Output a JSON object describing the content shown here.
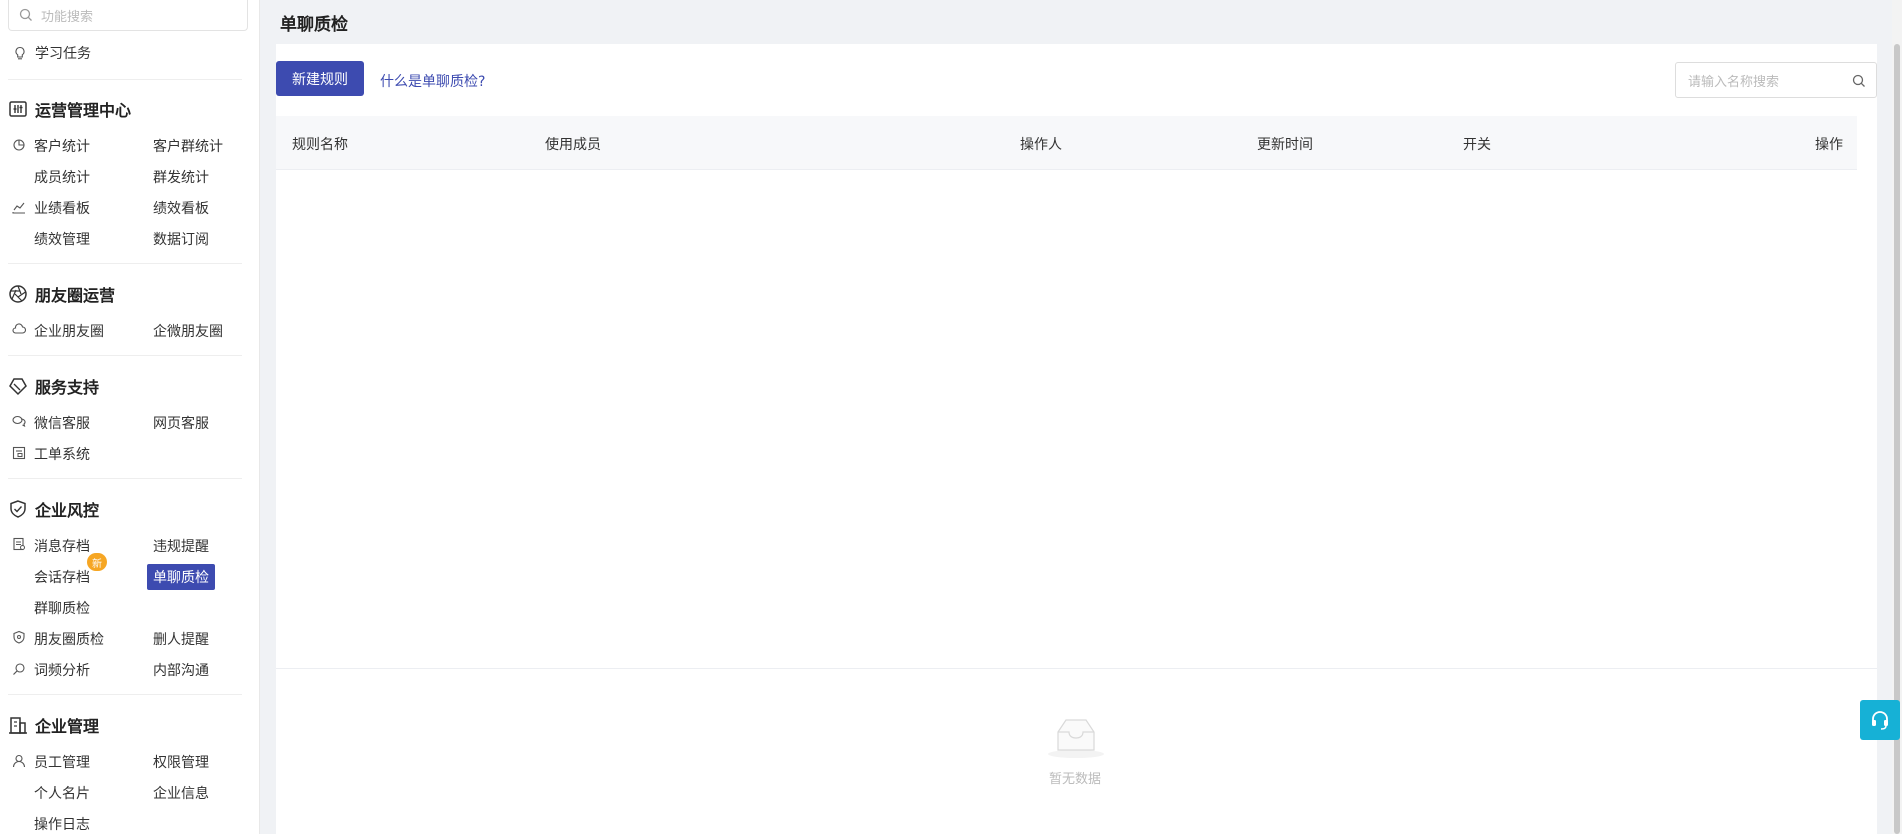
{
  "sidebar": {
    "search_placeholder": "功能搜索",
    "study": "学习任务",
    "sections": {
      "ops": {
        "title": "运营管理中心",
        "items": [
          "客户统计",
          "客户群统计",
          "成员统计",
          "群发统计",
          "业绩看板",
          "绩效看板",
          "绩效管理",
          "数据订阅"
        ]
      },
      "moments": {
        "title": "朋友圈运营",
        "items": [
          "企业朋友圈",
          "企微朋友圈"
        ]
      },
      "service": {
        "title": "服务支持",
        "items": [
          "微信客服",
          "网页客服",
          "工单系统"
        ]
      },
      "risk": {
        "title": "企业风控",
        "items": [
          "消息存档",
          "违规提醒",
          "会话存档",
          "单聊质检",
          "群聊质检",
          "朋友圈质检",
          "删人提醒",
          "词频分析",
          "内部沟通"
        ],
        "badge": "新"
      },
      "mgmt": {
        "title": "企业管理",
        "items": [
          "员工管理",
          "权限管理",
          "个人名片",
          "企业信息",
          "操作日志"
        ]
      }
    }
  },
  "main": {
    "title": "单聊质检",
    "new_rule": "新建规则",
    "help_link": "什么是单聊质检?",
    "search_placeholder": "请输入名称搜索",
    "columns": [
      "规则名称",
      "使用成员",
      "操作人",
      "更新时间",
      "开关",
      "操作"
    ],
    "empty_text": "暂无数据"
  },
  "colors": {
    "accent": "#3d4bb0",
    "badge": "#f6a623",
    "service": "#16b1d6"
  }
}
